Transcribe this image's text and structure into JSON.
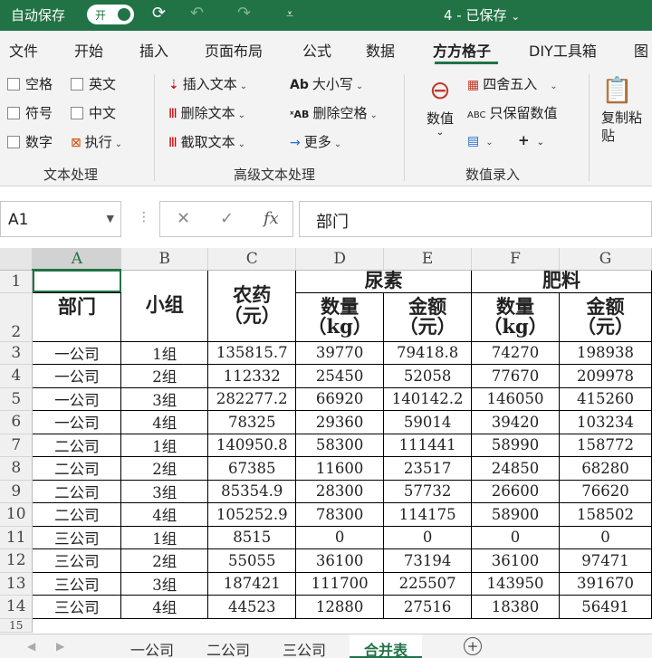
{
  "titlebar": {
    "autosave_label": "自动保存",
    "toggle_label": "开",
    "title": "4 - 已保存",
    "title_caret": "⌄"
  },
  "ribbon_tabs": [
    "文件",
    "开始",
    "插入",
    "页面布局",
    "公式",
    "数据",
    "方方格子",
    "DIY工具箱",
    "图"
  ],
  "active_tab": "方方格子",
  "ribbon": {
    "text_processing": {
      "label": "文本处理",
      "checkboxes": [
        "空格",
        "英文",
        "符号",
        "中文",
        "数字"
      ],
      "exec_label": "执行"
    },
    "advanced_text": {
      "label": "高级文本处理",
      "insert_text": "插入文本",
      "delete_text": "删除文本",
      "extract_text": "截取文本",
      "case": "大小写",
      "delete_space": "删除空格",
      "more": "更多"
    },
    "numeric_entry": {
      "label": "数值录入",
      "value_btn": "数值",
      "round": "四舍五入",
      "keep_value": "只保留数值",
      "abc_icon": "ABC"
    },
    "copy_paste": {
      "label": "复制粘贴"
    }
  },
  "formula_bar": {
    "name_box": "A1",
    "fx": "fx",
    "content": "部门"
  },
  "columns": [
    "A",
    "B",
    "C",
    "D",
    "E",
    "F",
    "G"
  ],
  "header": {
    "dept": "部门",
    "group": "小组",
    "pesticide": "农药",
    "pesticide_unit": "（元）",
    "urea": "尿素",
    "fertilizer": "肥料",
    "qty": "数量",
    "qty_unit": "（kg）",
    "amount": "金额",
    "amount_unit": "（元）"
  },
  "rows": [
    {
      "n": "3",
      "dept": "一公司",
      "group": "1组",
      "pesticide": "135815.7",
      "urea_qty": "39770",
      "urea_amt": "79418.8",
      "fert_qty": "74270",
      "fert_amt": "198938"
    },
    {
      "n": "4",
      "dept": "一公司",
      "group": "2组",
      "pesticide": "112332",
      "urea_qty": "25450",
      "urea_amt": "52058",
      "fert_qty": "77670",
      "fert_amt": "209978"
    },
    {
      "n": "5",
      "dept": "一公司",
      "group": "3组",
      "pesticide": "282277.2",
      "urea_qty": "66920",
      "urea_amt": "140142.2",
      "fert_qty": "146050",
      "fert_amt": "415260"
    },
    {
      "n": "6",
      "dept": "一公司",
      "group": "4组",
      "pesticide": "78325",
      "urea_qty": "29360",
      "urea_amt": "59014",
      "fert_qty": "39420",
      "fert_amt": "103234"
    },
    {
      "n": "7",
      "dept": "二公司",
      "group": "1组",
      "pesticide": "140950.8",
      "urea_qty": "58300",
      "urea_amt": "111441",
      "fert_qty": "58990",
      "fert_amt": "158772"
    },
    {
      "n": "8",
      "dept": "二公司",
      "group": "2组",
      "pesticide": "67385",
      "urea_qty": "11600",
      "urea_amt": "23517",
      "fert_qty": "24850",
      "fert_amt": "68280"
    },
    {
      "n": "9",
      "dept": "二公司",
      "group": "3组",
      "pesticide": "85354.9",
      "urea_qty": "28300",
      "urea_amt": "57732",
      "fert_qty": "26600",
      "fert_amt": "76620"
    },
    {
      "n": "10",
      "dept": "二公司",
      "group": "4组",
      "pesticide": "105252.9",
      "urea_qty": "78300",
      "urea_amt": "114175",
      "fert_qty": "58900",
      "fert_amt": "158502"
    },
    {
      "n": "11",
      "dept": "三公司",
      "group": "1组",
      "pesticide": "8515",
      "urea_qty": "0",
      "urea_amt": "0",
      "fert_qty": "0",
      "fert_amt": "0"
    },
    {
      "n": "12",
      "dept": "三公司",
      "group": "2组",
      "pesticide": "55055",
      "urea_qty": "36100",
      "urea_amt": "73194",
      "fert_qty": "36100",
      "fert_amt": "97471"
    },
    {
      "n": "13",
      "dept": "三公司",
      "group": "3组",
      "pesticide": "187421",
      "urea_qty": "111700",
      "urea_amt": "225507",
      "fert_qty": "143950",
      "fert_amt": "391670"
    },
    {
      "n": "14",
      "dept": "三公司",
      "group": "4组",
      "pesticide": "44523",
      "urea_qty": "12880",
      "urea_amt": "27516",
      "fert_qty": "18380",
      "fert_amt": "56491"
    }
  ],
  "header_row_numbers": [
    "1",
    "2"
  ],
  "extra_row_number": "15",
  "sheets": [
    "一公司",
    "二公司",
    "三公司",
    "合并表"
  ],
  "active_sheet": "合并表",
  "add_sheet_label": "+"
}
